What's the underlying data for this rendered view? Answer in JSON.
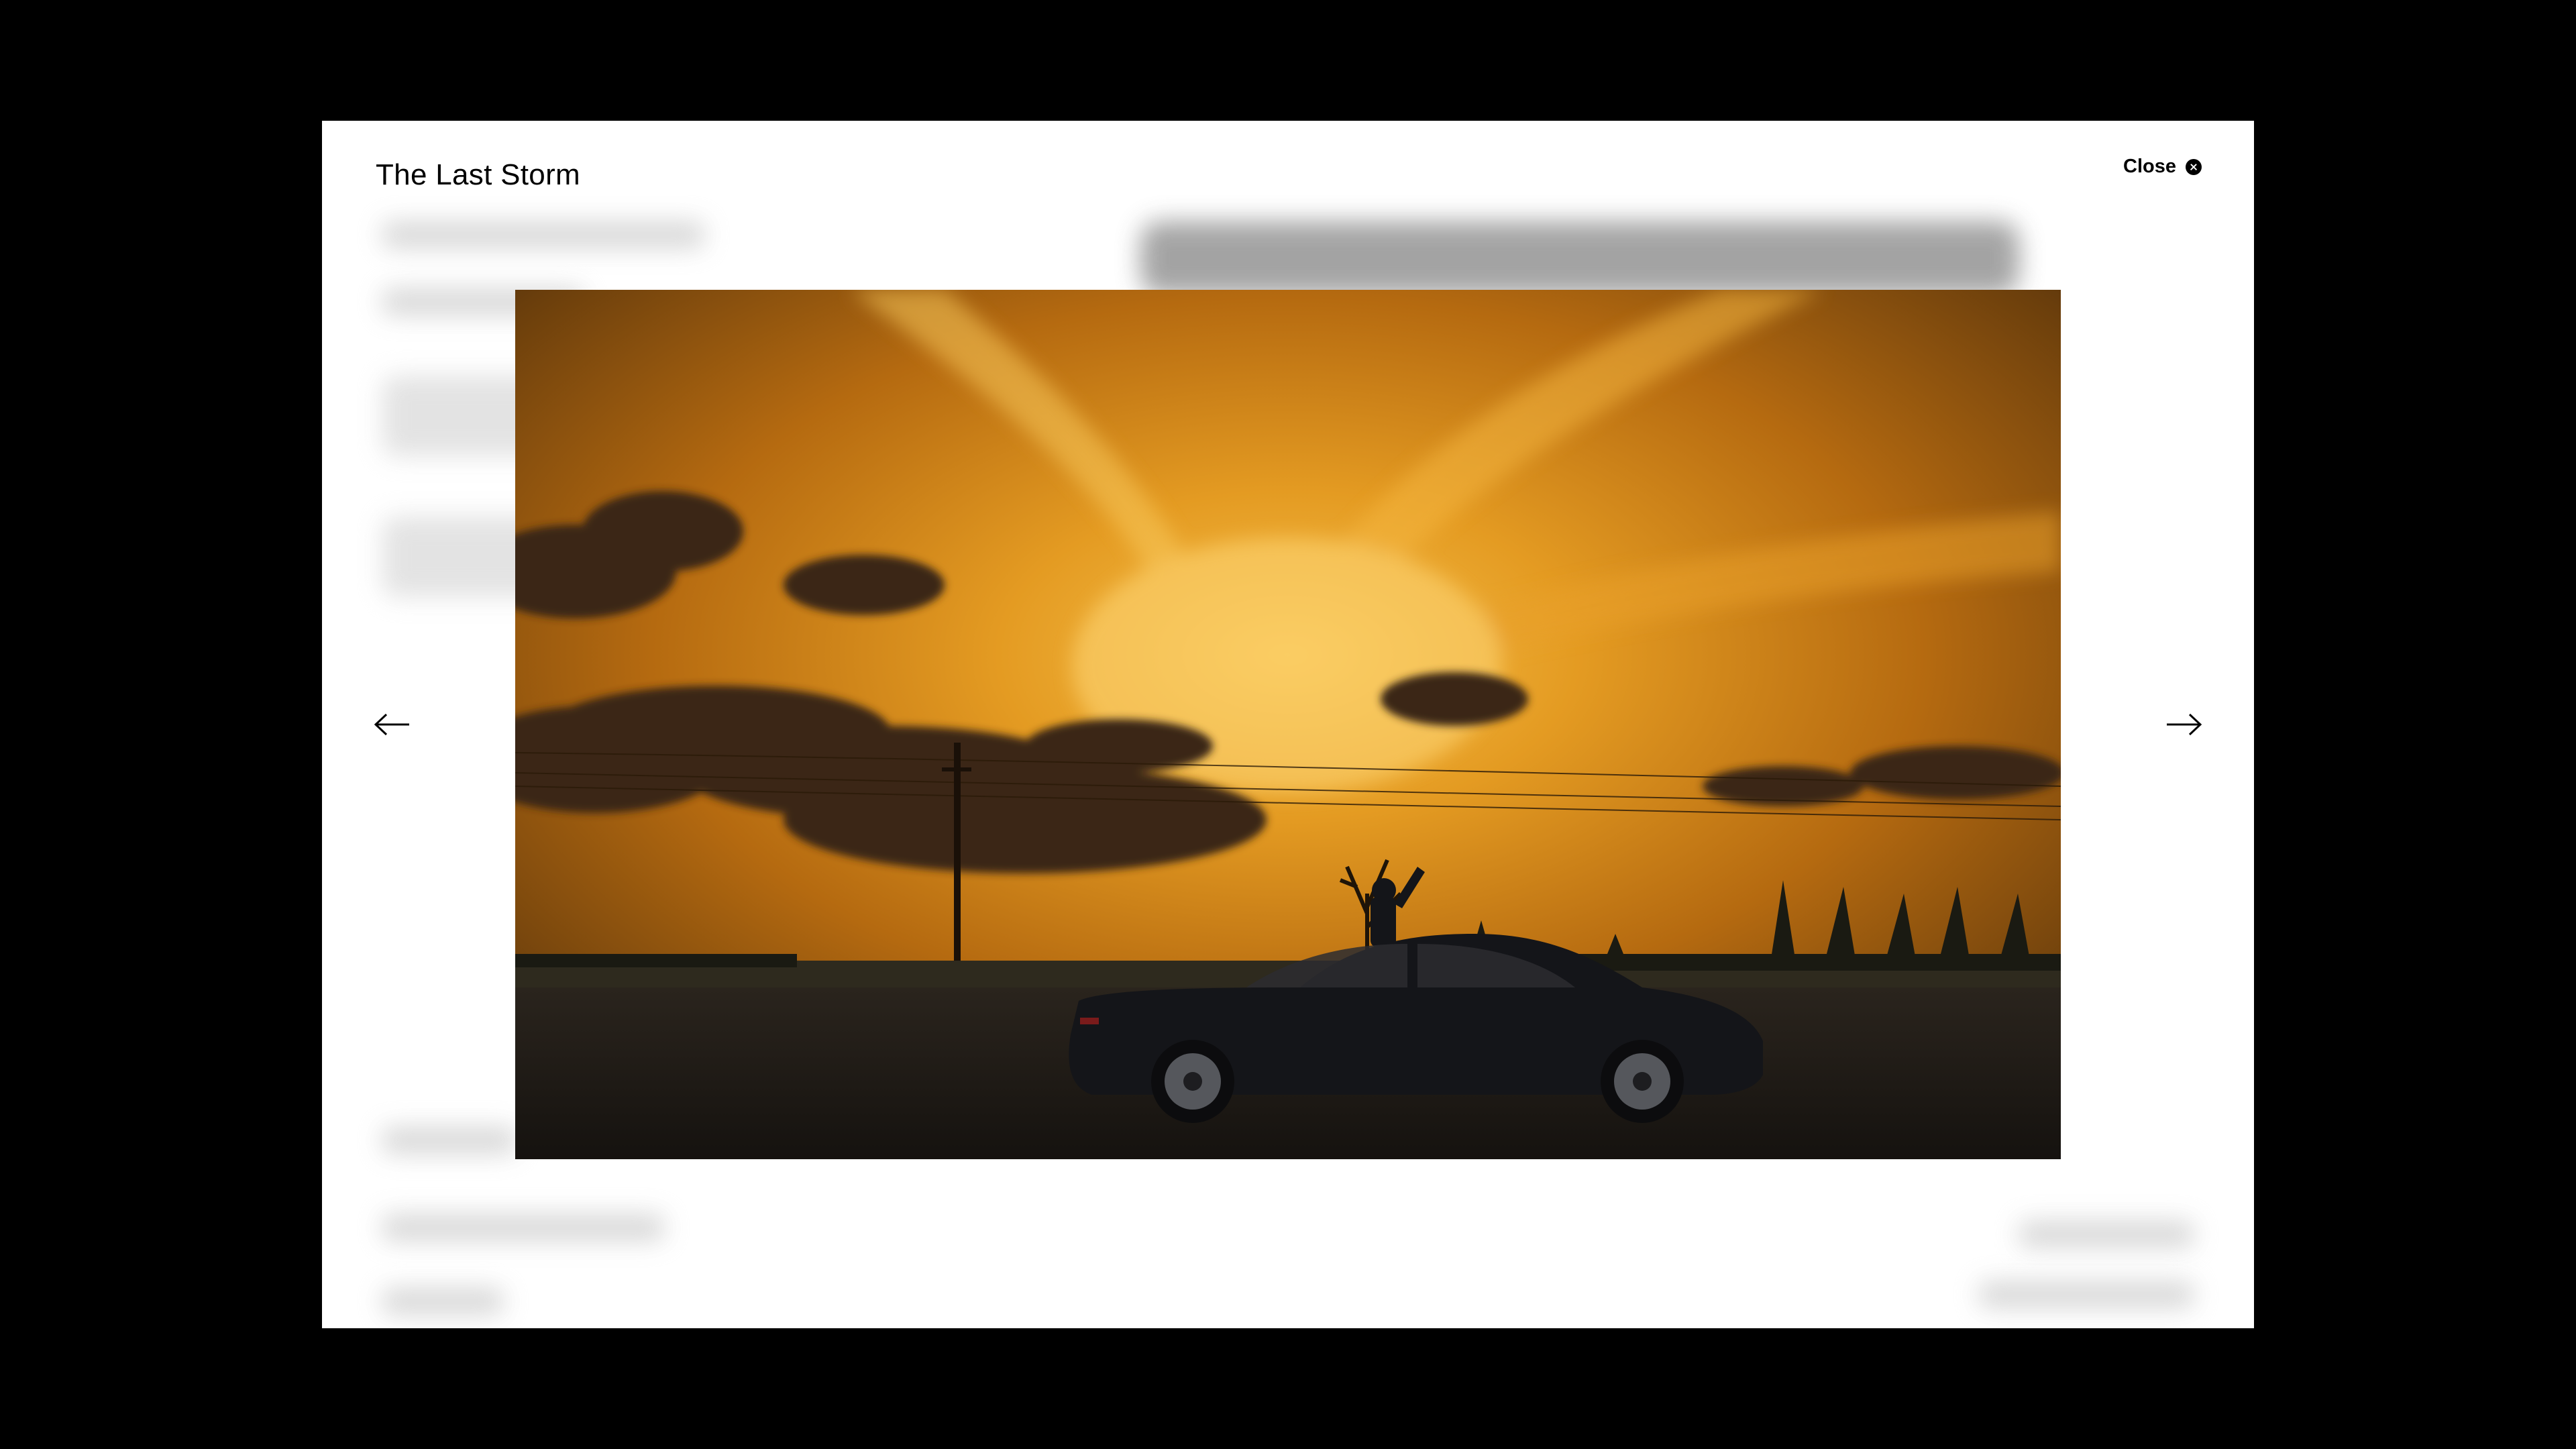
{
  "lightbox": {
    "title": "The Last Storm",
    "close_label": "Close",
    "icons": {
      "close": "close-circle-icon",
      "prev": "arrow-left-icon",
      "next": "arrow-right-icon"
    }
  },
  "photo": {
    "subject": "storm-sunset-car-silhouette",
    "palette": {
      "sky_glow": "#f2b23a",
      "sky_mid": "#c8780f",
      "sky_dark": "#4a2b0c",
      "ground": "#1f1a15",
      "car": "#16171b"
    }
  },
  "colors": {
    "backdrop": "#000000",
    "panel": "#ffffff",
    "text": "#000000"
  }
}
